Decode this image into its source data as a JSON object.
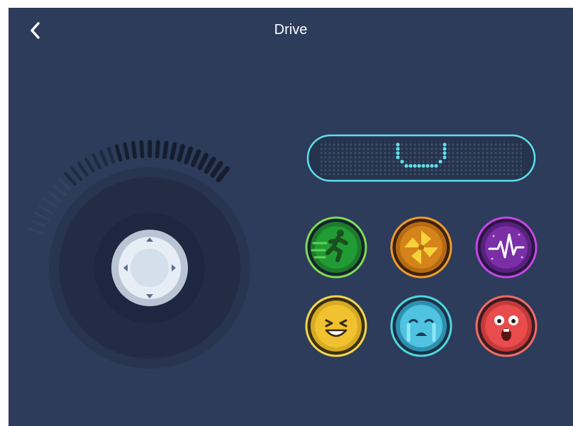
{
  "header": {
    "title": "Drive",
    "back_icon": "chevron-left-icon"
  },
  "joystick": {
    "speed_meter_icon": "speed-meter-arc",
    "direction_pad_icon": "direction-pad-icon",
    "arrow_icons": [
      "arrow-up-icon",
      "arrow-down-icon",
      "arrow-left-icon",
      "arrow-right-icon"
    ]
  },
  "face_display": {
    "expression": "smile-mouth",
    "accent_color": "#5ee0ea"
  },
  "actions": [
    {
      "icon": "running-man-icon",
      "ring_color": "#7ed957",
      "fill_color": "#1e7a2a"
    },
    {
      "icon": "pinwheel-icon",
      "ring_color": "#f19a2c",
      "fill_color": "#b86a12"
    },
    {
      "icon": "soundwave-icon",
      "ring_color": "#c347e6",
      "fill_color": "#5a2080"
    },
    {
      "icon": "laughing-face-icon",
      "ring_color": "#f6d54e",
      "fill_color": "#f0c230"
    },
    {
      "icon": "crying-face-icon",
      "ring_color": "#4fd4e2",
      "fill_color": "#3fb4d4"
    },
    {
      "icon": "shocked-face-icon",
      "ring_color": "#f06c67",
      "fill_color": "#e84c4c"
    }
  ],
  "colors": {
    "background": "#2c3c5a",
    "joystick_base": "#243048",
    "accent": "#5ee0ea"
  }
}
